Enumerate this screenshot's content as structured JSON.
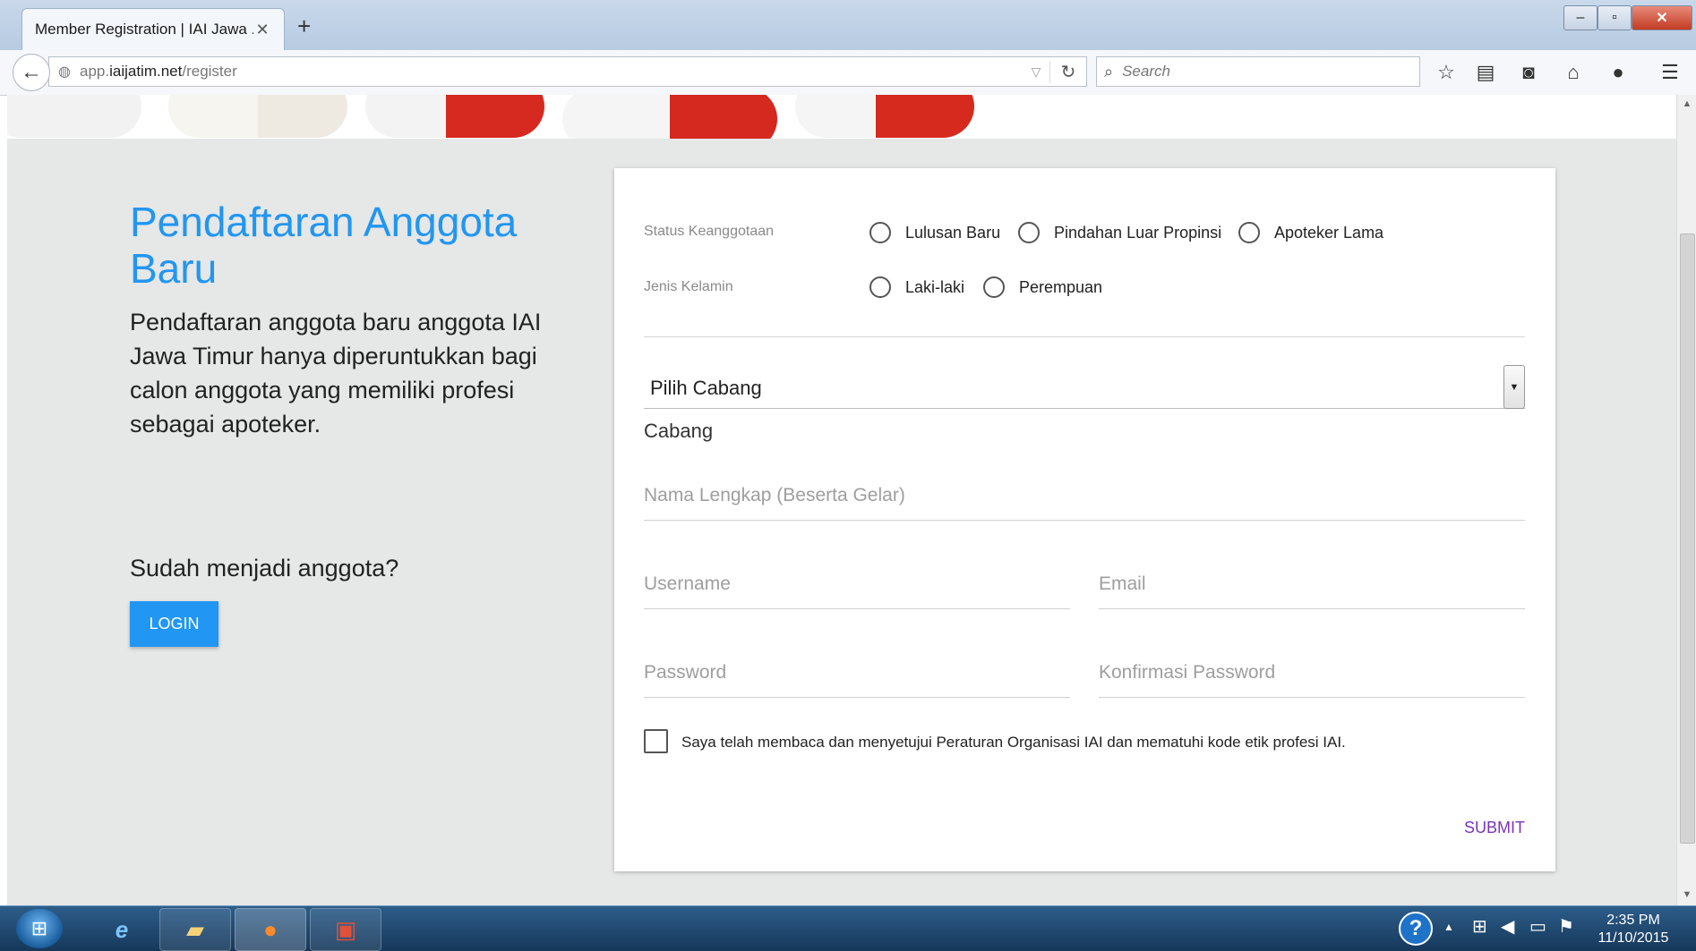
{
  "browser": {
    "tab_title": "Member Registration | IAI Jawa ...",
    "url_prefix": "app.",
    "url_host": "iaijatim.net",
    "url_path": "/register",
    "search_placeholder": "Search"
  },
  "left_panel": {
    "title": "Pendaftaran Anggota Baru",
    "description": "Pendaftaran anggota baru anggota IAI Jawa Timur hanya diperuntukkan bagi calon anggota yang memiliki profesi sebagai apoteker.",
    "member_question": "Sudah menjadi anggota?",
    "login_label": "LOGIN"
  },
  "form": {
    "status_label": "Status Keanggotaan",
    "status_options": [
      "Lulusan Baru",
      "Pindahan Luar Propinsi",
      "Apoteker Lama"
    ],
    "gender_label": "Jenis Kelamin",
    "gender_options": [
      "Laki-laki",
      "Perempuan"
    ],
    "branch_select_value": "Pilih Cabang",
    "branch_caption": "Cabang",
    "fullname_placeholder": "Nama Lengkap (Beserta Gelar)",
    "username_placeholder": "Username",
    "email_placeholder": "Email",
    "password_placeholder": "Password",
    "confirm_password_placeholder": "Konfirmasi Password",
    "agreement_text": "Saya telah membaca dan menyetujui Peraturan Organisasi IAI dan mematuhi kode etik profesi IAI.",
    "submit_label": "SUBMIT"
  },
  "taskbar": {
    "time": "2:35 PM",
    "date": "11/10/2015"
  },
  "colors": {
    "accent_blue": "#2196f3",
    "submit_purple": "#7b35b5",
    "page_bg": "#e6e7e7"
  }
}
